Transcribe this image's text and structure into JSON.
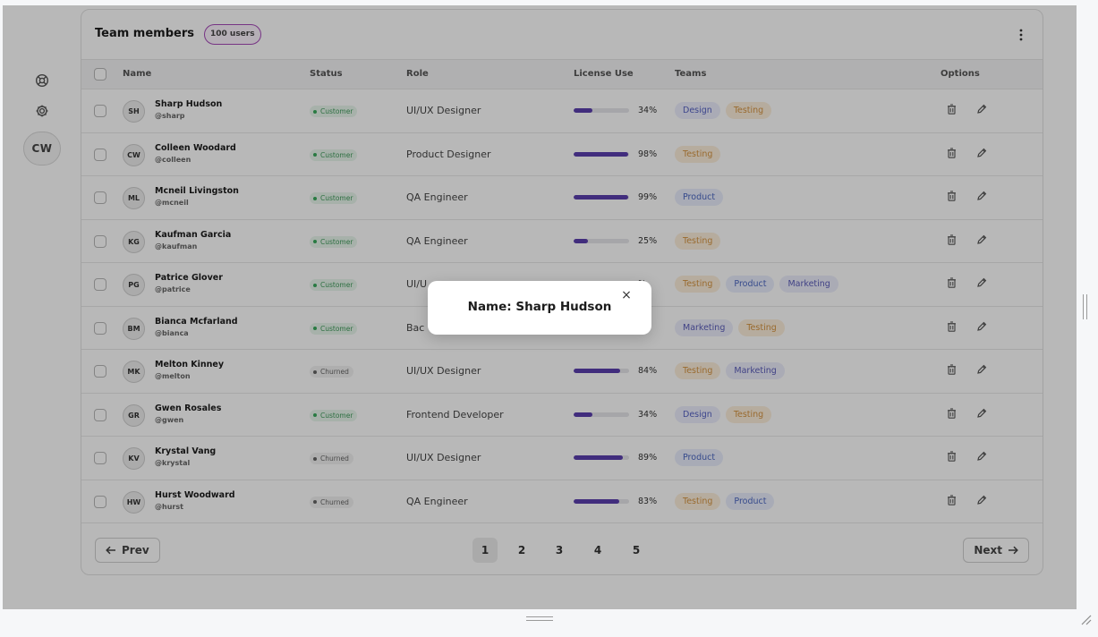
{
  "rail": {
    "avatar_initials": "CW"
  },
  "card": {
    "title": "Team members",
    "count_badge": "100 users"
  },
  "columns": {
    "name": "Name",
    "status": "Status",
    "role": "Role",
    "license": "License Use",
    "teams": "Teams",
    "options": "Options"
  },
  "rows": [
    {
      "initials": "SH",
      "name": "Sharp Hudson",
      "handle": "@sharp",
      "status": "Customer",
      "status_kind": "customer",
      "role": "UI/UX Designer",
      "license_pct": 34,
      "license_text": "34%",
      "teams": [
        "Design",
        "Testing"
      ]
    },
    {
      "initials": "CW",
      "name": "Colleen Woodard",
      "handle": "@colleen",
      "status": "Customer",
      "status_kind": "customer",
      "role": "Product Designer",
      "license_pct": 98,
      "license_text": "98%",
      "teams": [
        "Testing"
      ]
    },
    {
      "initials": "ML",
      "name": "Mcneil Livingston",
      "handle": "@mcneil",
      "status": "Customer",
      "status_kind": "customer",
      "role": "QA Engineer",
      "license_pct": 99,
      "license_text": "99%",
      "teams": [
        "Product"
      ]
    },
    {
      "initials": "KG",
      "name": "Kaufman Garcia",
      "handle": "@kaufman",
      "status": "Customer",
      "status_kind": "customer",
      "role": "QA Engineer",
      "license_pct": 25,
      "license_text": "25%",
      "teams": [
        "Testing"
      ]
    },
    {
      "initials": "PG",
      "name": "Patrice Glover",
      "handle": "@patrice",
      "status": "Customer",
      "status_kind": "customer",
      "role": "UI/U",
      "license_pct": 0,
      "license_text": "%",
      "teams": [
        "Testing",
        "Product",
        "Marketing"
      ]
    },
    {
      "initials": "BM",
      "name": "Bianca Mcfarland",
      "handle": "@bianca",
      "status": "Customer",
      "status_kind": "customer",
      "role": "Bac",
      "license_pct": 0,
      "license_text": "%",
      "teams": [
        "Marketing",
        "Testing"
      ]
    },
    {
      "initials": "MK",
      "name": "Melton Kinney",
      "handle": "@melton",
      "status": "Churned",
      "status_kind": "churned",
      "role": "UI/UX Designer",
      "license_pct": 84,
      "license_text": "84%",
      "teams": [
        "Testing",
        "Marketing"
      ]
    },
    {
      "initials": "GR",
      "name": "Gwen Rosales",
      "handle": "@gwen",
      "status": "Customer",
      "status_kind": "customer",
      "role": "Frontend Developer",
      "license_pct": 34,
      "license_text": "34%",
      "teams": [
        "Design",
        "Testing"
      ]
    },
    {
      "initials": "KV",
      "name": "Krystal Vang",
      "handle": "@krystal",
      "status": "Churned",
      "status_kind": "churned",
      "role": "UI/UX Designer",
      "license_pct": 89,
      "license_text": "89%",
      "teams": [
        "Product"
      ]
    },
    {
      "initials": "HW",
      "name": "Hurst Woodward",
      "handle": "@hurst",
      "status": "Churned",
      "status_kind": "churned",
      "role": "QA Engineer",
      "license_pct": 83,
      "license_text": "83%",
      "teams": [
        "Testing",
        "Product"
      ]
    }
  ],
  "pagination": {
    "prev_label": "Prev",
    "next_label": "Next",
    "pages": [
      "1",
      "2",
      "3",
      "4",
      "5"
    ],
    "current": "1"
  },
  "modal": {
    "text": "Name: Sharp Hudson",
    "close_glyph": "×"
  },
  "colors": {
    "license_bar": "#5b3fae",
    "badge_border": "#a549b8",
    "customer": "#3aaa5c",
    "overlay": "rgba(0,0,0,0.28)"
  },
  "icons": {
    "rail": [
      "lifebuoy-icon",
      "gear-icon"
    ],
    "header": "kebab-menu-icon",
    "row_actions": [
      "trash-icon",
      "pencil-icon"
    ],
    "pager": [
      "arrow-left-icon",
      "arrow-right-icon"
    ]
  }
}
